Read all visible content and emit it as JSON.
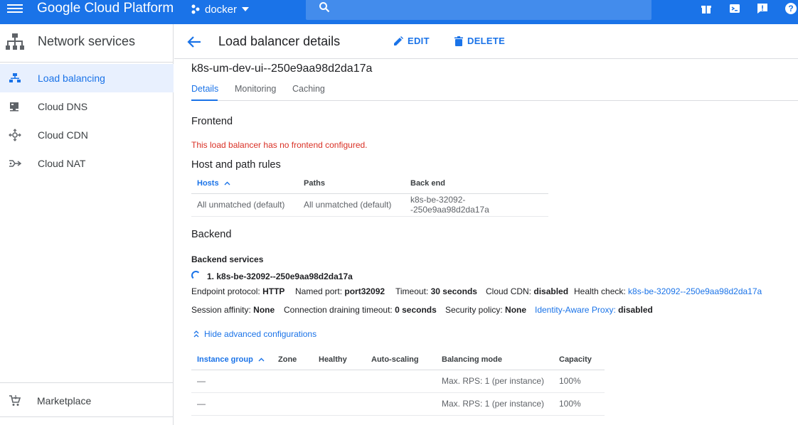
{
  "topbar": {
    "brand": "Google Cloud Platform",
    "project": "docker",
    "icons": [
      "menu-icon",
      "project-icon",
      "search-icon",
      "gift-icon",
      "terminal-icon",
      "feedback-icon",
      "help-icon"
    ]
  },
  "sidebar": {
    "title": "Network services",
    "items": [
      {
        "label": "Load balancing",
        "icon": "load-balancing-icon",
        "active": true
      },
      {
        "label": "Cloud DNS",
        "icon": "dns-icon"
      },
      {
        "label": "Cloud CDN",
        "icon": "cdn-icon"
      },
      {
        "label": "Cloud NAT",
        "icon": "nat-icon"
      }
    ],
    "marketplace": "Marketplace"
  },
  "header": {
    "title": "Load balancer details",
    "edit": "EDIT",
    "delete": "DELETE"
  },
  "lb_name": "k8s-um-dev-ui--250e9aa98d2da17a",
  "tabs": [
    "Details",
    "Monitoring",
    "Caching"
  ],
  "frontend": {
    "heading": "Frontend",
    "message": "This load balancer has no frontend configured."
  },
  "host_rules": {
    "heading": "Host and path rules",
    "columns": [
      "Hosts",
      "Paths",
      "Back end"
    ],
    "rows": [
      [
        "All unmatched (default)",
        "All unmatched (default)",
        "k8s-be-32092--250e9aa98d2da17a"
      ]
    ]
  },
  "backend": {
    "heading": "Backend",
    "services_label": "Backend services",
    "service_name": "1. k8s-be-32092--250e9aa98d2da17a",
    "endpoint_protocol_label": "Endpoint protocol:",
    "endpoint_protocol": "HTTP",
    "named_port_label": "Named port:",
    "named_port": "port32092",
    "timeout_label": "Timeout:",
    "timeout": "30 seconds",
    "cdn_label": "Cloud CDN:",
    "cdn": "disabled",
    "health_label": "Health check:",
    "health": "k8s-be-32092--250e9aa98d2da17a",
    "affinity_label": "Session affinity:",
    "affinity": "None",
    "draining_label": "Connection draining timeout:",
    "draining": "0 seconds",
    "security_label": "Security policy:",
    "security": "None",
    "iap_label": "Identity-Aware Proxy:",
    "iap": "disabled",
    "advanced": "Hide advanced configurations"
  },
  "instance_table": {
    "columns": [
      "Instance group",
      "Zone",
      "Healthy",
      "Auto-scaling",
      "Balancing mode",
      "Capacity"
    ],
    "rows": [
      [
        "—",
        "",
        "",
        "",
        "Max. RPS: 1 (per instance)",
        "100%"
      ],
      [
        "—",
        "",
        "",
        "",
        "Max. RPS: 1 (per instance)",
        "100%"
      ]
    ]
  }
}
